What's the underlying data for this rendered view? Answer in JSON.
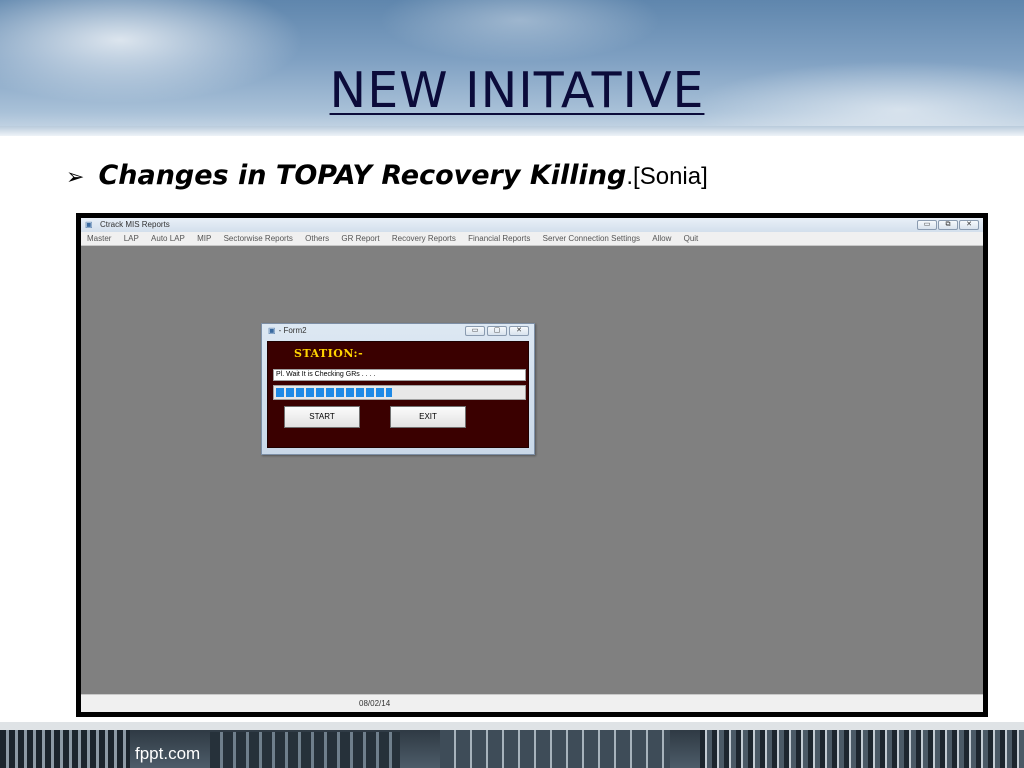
{
  "slide": {
    "title": "NEW INITATIVE",
    "bullet_marker": "➢",
    "bullet_bold": "Changes in TOPAY Recovery Killing",
    "bullet_plain": ".[Sonia]",
    "footer_brand": "fppt.com"
  },
  "app": {
    "window_title": "Ctrack MIS Reports",
    "window_buttons": [
      "minimize",
      "restore",
      "close"
    ],
    "menu": [
      "Master",
      "LAP",
      "Auto LAP",
      "MIP",
      "Sectorwise Reports",
      "Others",
      "GR Report",
      "Recovery Reports",
      "Financial Reports",
      "Server Connection Settings",
      "Allow",
      "Quit"
    ],
    "status_date": "08/02/14"
  },
  "dialog": {
    "title": "- Form2",
    "station_label": "STATION:-",
    "status_text": "Pl. Wait It is Checking  GRs  . . . .",
    "progress_fraction": 0.47,
    "start_label": "START",
    "exit_label": "EXIT"
  },
  "colors": {
    "dialog_body": "#3a0000",
    "station_text": "#ffd400",
    "progress": "#1e8ae6",
    "workspace": "#808080",
    "title_text": "#0b0b3a"
  }
}
